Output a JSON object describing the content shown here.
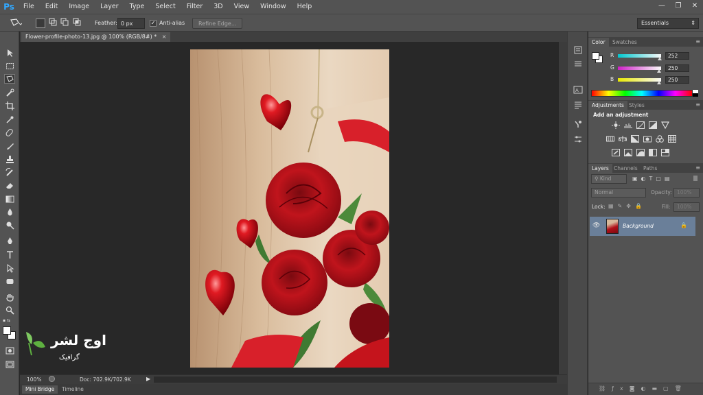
{
  "app": {
    "logo": "Ps"
  },
  "menu": [
    "File",
    "Edit",
    "Image",
    "Layer",
    "Type",
    "Select",
    "Filter",
    "3D",
    "View",
    "Window",
    "Help"
  ],
  "window_controls": {
    "minimize": "—",
    "restore": "❐",
    "close": "✕"
  },
  "options": {
    "feather_label": "Feather:",
    "feather_value": "0 px",
    "antialias_label": "Anti-alias",
    "antialias_checked": "✓",
    "refine_label": "Refine Edge...",
    "workspace": "Essentials"
  },
  "document": {
    "tab_title": "Flower-profile-photo-13.jpg @ 100% (RGB/8#) *",
    "close": "×"
  },
  "status": {
    "zoom": "100%",
    "doc": "Doc: 702.9K/702.9K",
    "arrow": "▶"
  },
  "bottom_tabs": [
    "Mini Bridge",
    "Timeline"
  ],
  "color_panel": {
    "tabs": [
      "Color",
      "Swatches"
    ],
    "channels": [
      {
        "label": "R",
        "value": "252"
      },
      {
        "label": "G",
        "value": "250"
      },
      {
        "label": "B",
        "value": "250"
      }
    ],
    "colors": {
      "r_track": "#00c8d0",
      "g_track": "#d020c8",
      "b_track": "#e8e800"
    }
  },
  "adjustments_panel": {
    "tabs": [
      "Adjustments",
      "Styles"
    ],
    "heading": "Add an adjustment"
  },
  "layers_panel": {
    "tabs": [
      "Layers",
      "Channels",
      "Paths"
    ],
    "kind": "Kind",
    "blend_mode": "Normal",
    "opacity_label": "Opacity:",
    "opacity_value": "100%",
    "lock_label": "Lock:",
    "fill_label": "Fill:",
    "fill_value": "100%",
    "layer_name": "Background"
  },
  "watermark": {
    "brand": "اوج لشر",
    "sub": "گرافیک"
  }
}
